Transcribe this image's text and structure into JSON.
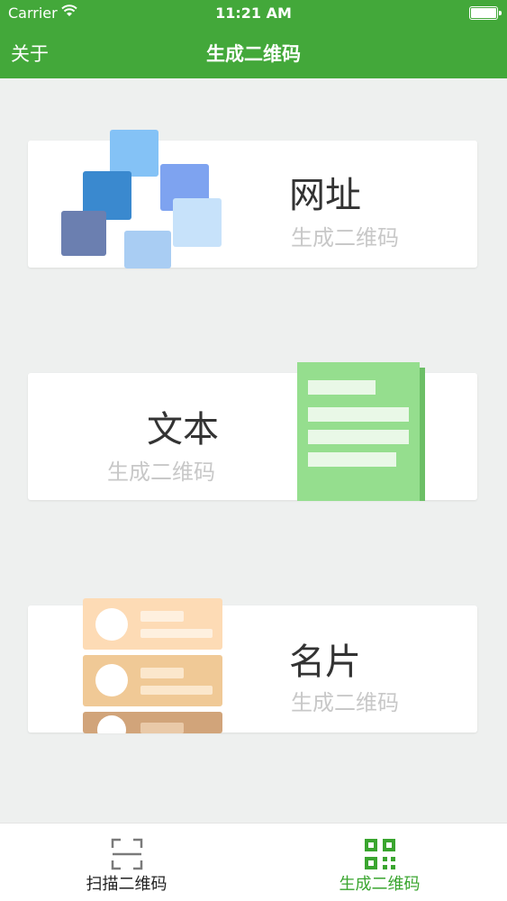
{
  "status_bar": {
    "carrier": "Carrier",
    "time": "11:21 AM"
  },
  "nav": {
    "left_button": "关于",
    "title": "生成二维码"
  },
  "cards": [
    {
      "title": "网址",
      "subtitle": "生成二维码"
    },
    {
      "title": "文本",
      "subtitle": "生成二维码"
    },
    {
      "title": "名片",
      "subtitle": "生成二维码"
    }
  ],
  "tabs": [
    {
      "label": "扫描二维码",
      "icon": "scan-frame-icon"
    },
    {
      "label": "生成二维码",
      "icon": "qr-code-icon"
    }
  ],
  "colors": {
    "primary": "#43a83a",
    "active_tab": "#3aa52f"
  }
}
